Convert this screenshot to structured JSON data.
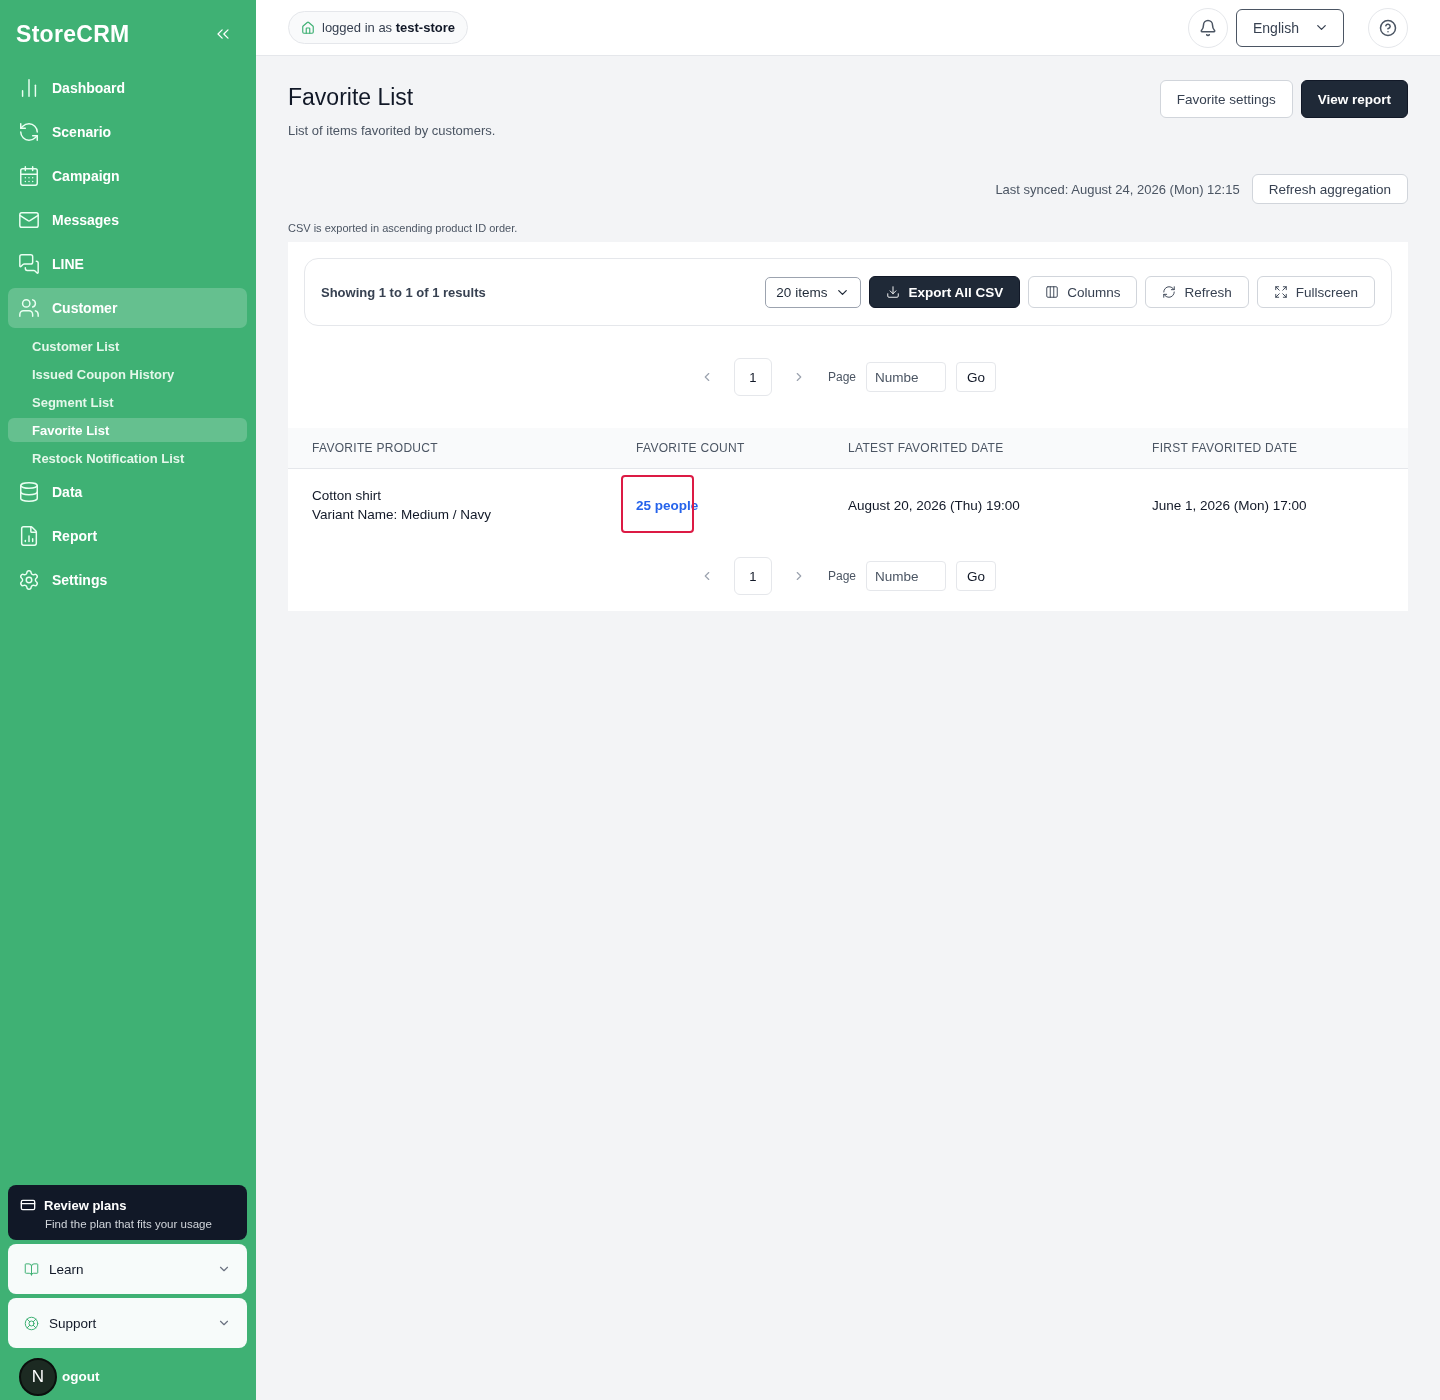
{
  "sidebar": {
    "brand": "StoreCRM",
    "nav": [
      {
        "label": "Dashboard",
        "selected": false
      },
      {
        "label": "Scenario",
        "selected": false
      },
      {
        "label": "Campaign",
        "selected": false
      },
      {
        "label": "Messages",
        "selected": false
      },
      {
        "label": "LINE",
        "selected": false
      },
      {
        "label": "Customer",
        "selected": true,
        "children": [
          {
            "label": "Customer List",
            "selected": false
          },
          {
            "label": "Issued Coupon History",
            "selected": false
          },
          {
            "label": "Segment List",
            "selected": false
          },
          {
            "label": "Favorite List",
            "selected": true
          },
          {
            "label": "Restock Notification List",
            "selected": false
          }
        ]
      },
      {
        "label": "Data",
        "selected": false
      },
      {
        "label": "Report",
        "selected": false
      },
      {
        "label": "Settings",
        "selected": false
      }
    ],
    "promo": {
      "title": "Review plans",
      "text": "Find the plan that fits your usage"
    },
    "panels": [
      {
        "label": "Learn",
        "expanded": false
      },
      {
        "label": "Support",
        "expanded": false
      }
    ],
    "logout": "ogout",
    "avatar": "N"
  },
  "header": {
    "login": "logged in as **test-store**",
    "language": "English"
  },
  "page": {
    "title": "Favorite List",
    "subtitle": "List of items favorited by customers.",
    "actions": [
      {
        "label": "Favorite settings",
        "kind": "secondary"
      },
      {
        "label": "View report",
        "kind": "primary"
      }
    ],
    "last_synced": "Last synced: August 24, 2026 (Mon) 12:15",
    "refresh_aggregation": "Refresh aggregation",
    "csv_note": "CSV is exported in ascending product ID order."
  },
  "toolbar": {
    "results": "Showing 1 to 1 of 1 results",
    "page_size": "20 items",
    "buttons": [
      {
        "label": "Export All CSV",
        "kind": "primary"
      },
      {
        "label": "Columns",
        "kind": "secondary"
      },
      {
        "label": "Refresh",
        "kind": "secondary"
      },
      {
        "label": "Fullscreen",
        "kind": "secondary"
      }
    ]
  },
  "pagination": [
    {
      "page": "1",
      "page_label": "Page",
      "placeholder": "Numbe",
      "go": "Go"
    },
    {
      "page": "1",
      "page_label": "Page",
      "placeholder": "Numbe",
      "go": "Go"
    }
  ],
  "table": {
    "columns": [
      "FAVORITE PRODUCT",
      "FAVORITE COUNT",
      "LATEST FAVORITED DATE",
      "FIRST FAVORITED DATE"
    ],
    "rows": [
      {
        "product": "Cotton shirt",
        "variant": "Variant Name: Medium / Navy",
        "count": "25 people",
        "highlighted": true,
        "latest": "August 20, 2026 (Thu) 19:00",
        "first": "June 1, 2026 (Mon) 17:00"
      }
    ]
  }
}
